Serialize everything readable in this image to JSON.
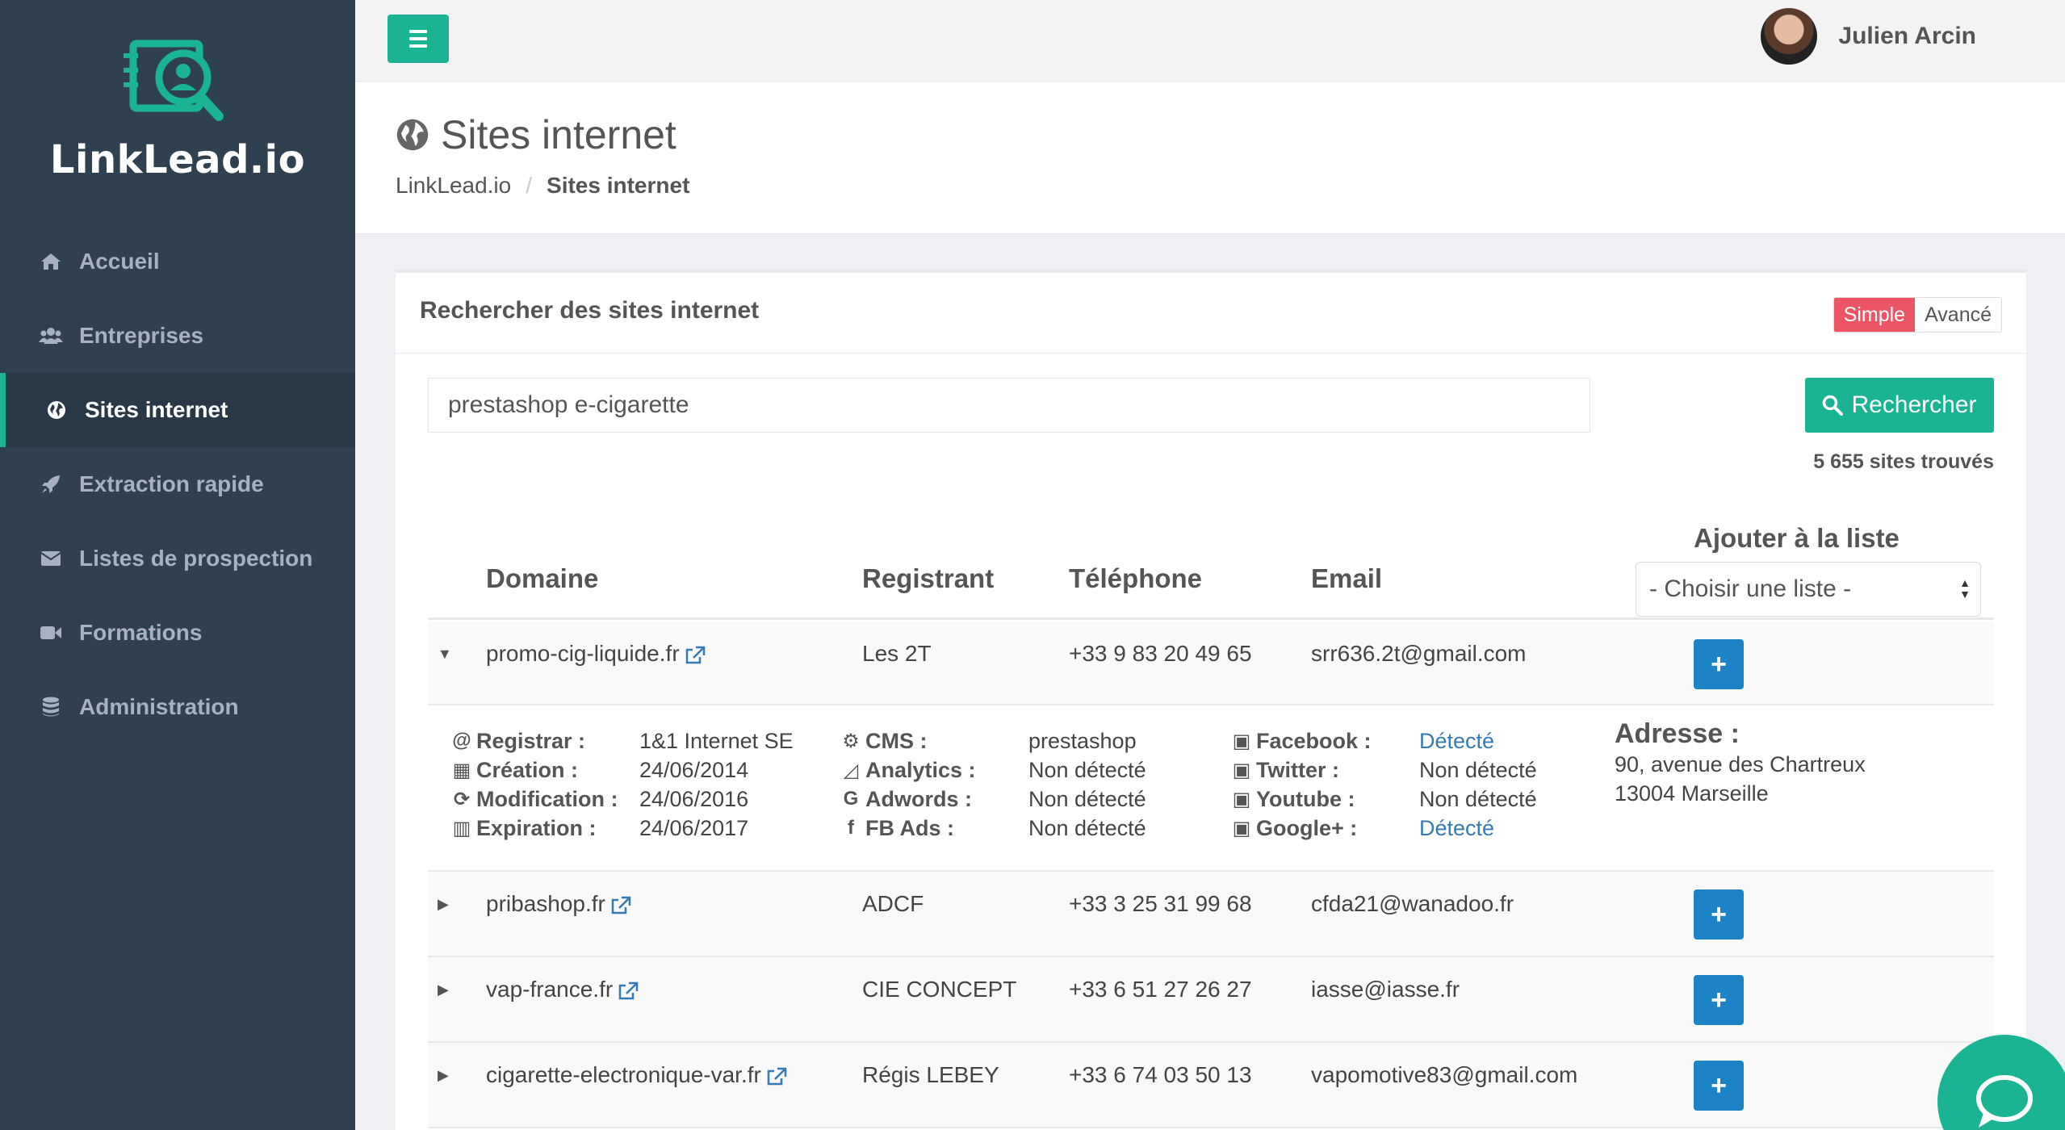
{
  "app": {
    "logo_text": "LinkLead.io"
  },
  "sidebar": {
    "items": [
      {
        "label": "Accueil",
        "icon": "home-icon"
      },
      {
        "label": "Entreprises",
        "icon": "users-icon"
      },
      {
        "label": "Sites internet",
        "icon": "globe-icon",
        "active": true
      },
      {
        "label": "Extraction rapide",
        "icon": "rocket-icon"
      },
      {
        "label": "Listes de prospection",
        "icon": "envelope-icon"
      },
      {
        "label": "Formations",
        "icon": "video-camera-icon"
      },
      {
        "label": "Administration",
        "icon": "database-icon"
      }
    ]
  },
  "header": {
    "user_name": "Julien Arcin"
  },
  "page": {
    "title": "Sites internet",
    "breadcrumb": {
      "root": "LinkLead.io",
      "sep": "/",
      "current": "Sites internet"
    }
  },
  "panel": {
    "title": "Rechercher des sites internet",
    "mode_simple": "Simple",
    "mode_advanced": "Avancé",
    "search_value": "prestashop e-cigarette",
    "search_button": "Rechercher",
    "results_count": "5 655 sites trouvés"
  },
  "table": {
    "headers": {
      "domain": "Domaine",
      "registrant": "Registrant",
      "phone": "Téléphone",
      "email": "Email",
      "add_list": "Ajouter à la liste"
    },
    "list_select": "- Choisir une liste -",
    "add_symbol": "+",
    "rows": [
      {
        "domain": "promo-cig-liquide.fr",
        "registrant": "Les 2T",
        "phone": "+33 9 83 20 49 65",
        "email": "srr636.2t@gmail.com",
        "expanded": true
      },
      {
        "domain": "pribashop.fr",
        "registrant": "ADCF",
        "phone": "+33 3 25 31 99 68",
        "email": "cfda21@wanadoo.fr"
      },
      {
        "domain": "vap-france.fr",
        "registrant": "CIE CONCEPT",
        "phone": "+33 6 51 27 26 27",
        "email": "iasse@iasse.fr"
      },
      {
        "domain": "cigarette-electronique-var.fr",
        "registrant": "Régis LEBEY",
        "phone": "+33 6 74 03 50 13",
        "email": "vapomotive83@gmail.com"
      }
    ]
  },
  "details": {
    "registrar_label": "Registrar :",
    "registrar": "1&1 Internet SE",
    "creation_label": "Création :",
    "creation": "24/06/2014",
    "modification_label": "Modification :",
    "modification": "24/06/2016",
    "expiration_label": "Expiration :",
    "expiration": "24/06/2017",
    "cms_label": "CMS :",
    "cms": "prestashop",
    "analytics_label": "Analytics :",
    "analytics": "Non détecté",
    "adwords_label": "Adwords :",
    "adwords": "Non détecté",
    "fbads_label": "FB Ads :",
    "fbads": "Non détecté",
    "facebook_label": "Facebook :",
    "facebook": "Détecté",
    "twitter_label": "Twitter :",
    "twitter": "Non détecté",
    "youtube_label": "Youtube :",
    "youtube": "Non détecté",
    "googleplus_label": "Google+ :",
    "googleplus": "Détecté",
    "address_label": "Adresse :",
    "address_line1": "90, avenue des Chartreux",
    "address_line2": "13004 Marseille"
  },
  "colors": {
    "accent": "#1ab394",
    "sidebar": "#2f4050",
    "primary": "#1c84c6",
    "danger": "#ed5565",
    "link": "#337ab7"
  }
}
